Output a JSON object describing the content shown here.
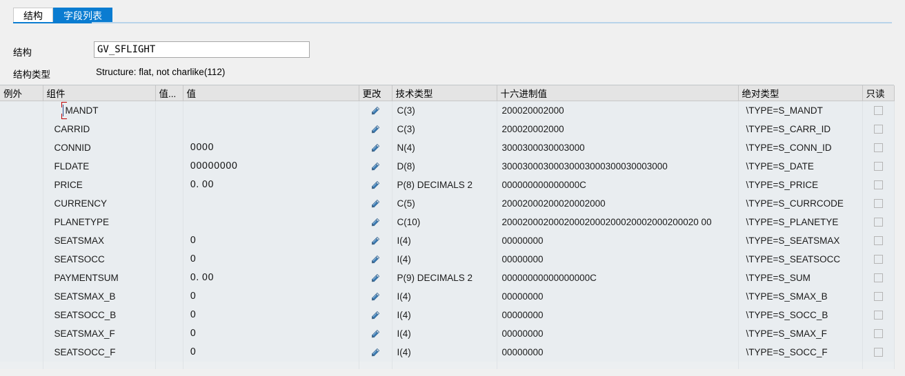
{
  "tabs": [
    {
      "label": "结构",
      "active": false,
      "name": "tab-structure"
    },
    {
      "label": "字段列表",
      "active": true,
      "name": "tab-field-list"
    }
  ],
  "form": {
    "structure_label": "结构",
    "structure_value": "GV_SFLIGHT",
    "structure_placeholder": "",
    "structure_type_label": "结构类型",
    "structure_type_value": "Structure: flat, not charlike(112)"
  },
  "grid": {
    "columns": [
      {
        "key": "exception",
        "label": "例外"
      },
      {
        "key": "component",
        "label": "组件"
      },
      {
        "key": "value_short",
        "label": "值..."
      },
      {
        "key": "value",
        "label": "值"
      },
      {
        "key": "change",
        "label": "更改"
      },
      {
        "key": "technical_type",
        "label": "技术类型"
      },
      {
        "key": "hex_value",
        "label": "十六进制值"
      },
      {
        "key": "absolute_type",
        "label": "绝对类型"
      },
      {
        "key": "readonly",
        "label": "只读"
      }
    ],
    "rows": [
      {
        "component": "MANDT",
        "value": "",
        "technical_type": "C(3)",
        "hex_value": "200020002000",
        "absolute_type": "\\TYPE=S_MANDT",
        "readonly": false,
        "selected": true
      },
      {
        "component": "CARRID",
        "value": "",
        "technical_type": "C(3)",
        "hex_value": "200020002000",
        "absolute_type": "\\TYPE=S_CARR_ID",
        "readonly": false,
        "selected": false
      },
      {
        "component": "CONNID",
        "value": "0000",
        "technical_type": "N(4)",
        "hex_value": "3000300030003000",
        "absolute_type": "\\TYPE=S_CONN_ID",
        "readonly": false,
        "selected": false
      },
      {
        "component": "FLDATE",
        "value": "00000000",
        "technical_type": "D(8)",
        "hex_value": "30003000300030003000300030003000",
        "absolute_type": "\\TYPE=S_DATE",
        "readonly": false,
        "selected": false
      },
      {
        "component": "PRICE",
        "value": "0. 00",
        "technical_type": "P(8) DECIMALS 2",
        "hex_value": "000000000000000C",
        "absolute_type": "\\TYPE=S_PRICE",
        "readonly": false,
        "selected": false
      },
      {
        "component": "CURRENCY",
        "value": "",
        "technical_type": "C(5)",
        "hex_value": "20002000200020002000",
        "absolute_type": "\\TYPE=S_CURRCODE",
        "readonly": false,
        "selected": false
      },
      {
        "component": "PLANETYPE",
        "value": "",
        "technical_type": "C(10)",
        "hex_value": "20002000200020002000200020002000200020 00",
        "absolute_type": "\\TYPE=S_PLANETYE",
        "readonly": false,
        "selected": false
      },
      {
        "component": "SEATSMAX",
        "value": "0",
        "technical_type": "I(4)",
        "hex_value": "00000000",
        "absolute_type": "\\TYPE=S_SEATSMAX",
        "readonly": false,
        "selected": false
      },
      {
        "component": "SEATSOCC",
        "value": "0",
        "technical_type": "I(4)",
        "hex_value": "00000000",
        "absolute_type": "\\TYPE=S_SEATSOCC",
        "readonly": false,
        "selected": false
      },
      {
        "component": "PAYMENTSUM",
        "value": "0. 00",
        "technical_type": "P(9) DECIMALS 2",
        "hex_value": "00000000000000000C",
        "absolute_type": "\\TYPE=S_SUM",
        "readonly": false,
        "selected": false
      },
      {
        "component": "SEATSMAX_B",
        "value": "0",
        "technical_type": "I(4)",
        "hex_value": "00000000",
        "absolute_type": "\\TYPE=S_SMAX_B",
        "readonly": false,
        "selected": false
      },
      {
        "component": "SEATSOCC_B",
        "value": "0",
        "technical_type": "I(4)",
        "hex_value": "00000000",
        "absolute_type": "\\TYPE=S_SOCC_B",
        "readonly": false,
        "selected": false
      },
      {
        "component": "SEATSMAX_F",
        "value": "0",
        "technical_type": "I(4)",
        "hex_value": "00000000",
        "absolute_type": "\\TYPE=S_SMAX_F",
        "readonly": false,
        "selected": false
      },
      {
        "component": "SEATSOCC_F",
        "value": "0",
        "technical_type": "I(4)",
        "hex_value": "00000000",
        "absolute_type": "\\TYPE=S_SOCC_F",
        "readonly": false,
        "selected": false
      }
    ]
  },
  "icons": {
    "change_pencil": "pencil-icon",
    "readonly_checkbox": "checkbox-icon"
  },
  "colors": {
    "accent_blue": "#0a7cd1",
    "grid_row_bg": "#e9edf0",
    "header_bg": "#e4e4e4",
    "selection_red": "#c00000",
    "pencil_blue": "#3b7cb5"
  }
}
